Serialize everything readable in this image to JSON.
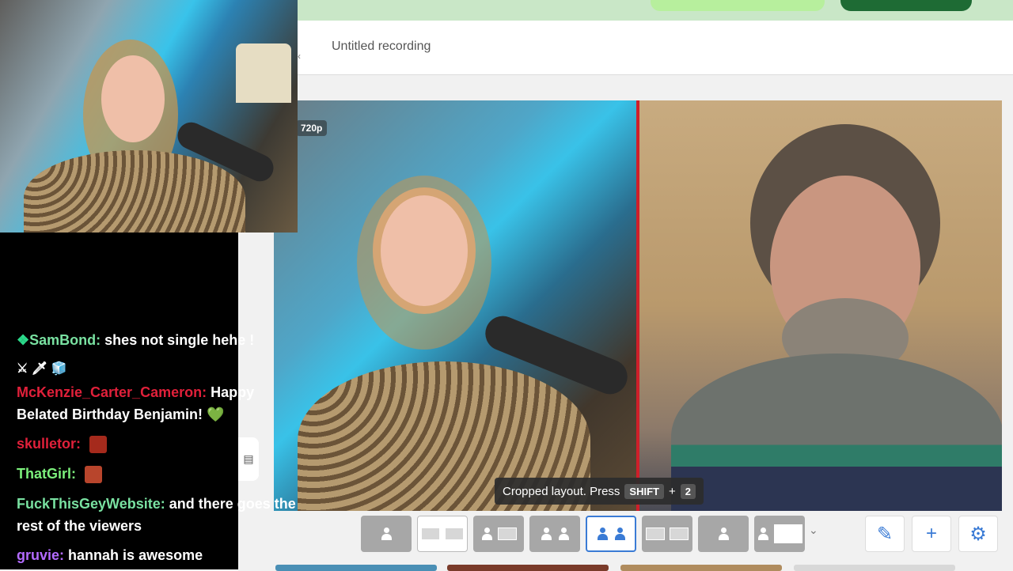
{
  "header": {
    "back_glyph": "‹",
    "title": "Untitled recording"
  },
  "stage": {
    "resolution_badge": "720p"
  },
  "tooltip": {
    "text": "Cropped layout. Press",
    "key1": "SHIFT",
    "plus": "+",
    "key2": "2"
  },
  "toolbar": {
    "chevron": "⌄",
    "edit_icon": "✎",
    "add_icon": "+",
    "settings_icon": "⚙"
  },
  "side_handle_icon": "▤",
  "chat": {
    "messages": [
      {
        "user": "SamBond",
        "user_color": "#79e1a1",
        "text": "shes not single hehe !"
      },
      {
        "badges": "⚔ 🗡 🧊"
      },
      {
        "user": "McKenzie_Carter_Cameron",
        "user_color": "#e0203a",
        "text": "Happy Belated Birthday Benjamin! 💚"
      },
      {
        "user": "skulletor",
        "user_color": "#e0203a",
        "text": ""
      },
      {
        "user": "ThatGirl",
        "user_color": "#7cf07c",
        "text": ""
      },
      {
        "user": "FuckThisGeyWebsite",
        "user_color": "#79e1a1",
        "text": "and there goes the rest of the viewers"
      },
      {
        "user": "gruvie",
        "user_color": "#b36bff",
        "text": "hannah is awesome"
      }
    ]
  },
  "colors": {
    "accent": "#3a7bd5",
    "divider": "#cf1f2a",
    "dark_green": "#1e6b34"
  }
}
